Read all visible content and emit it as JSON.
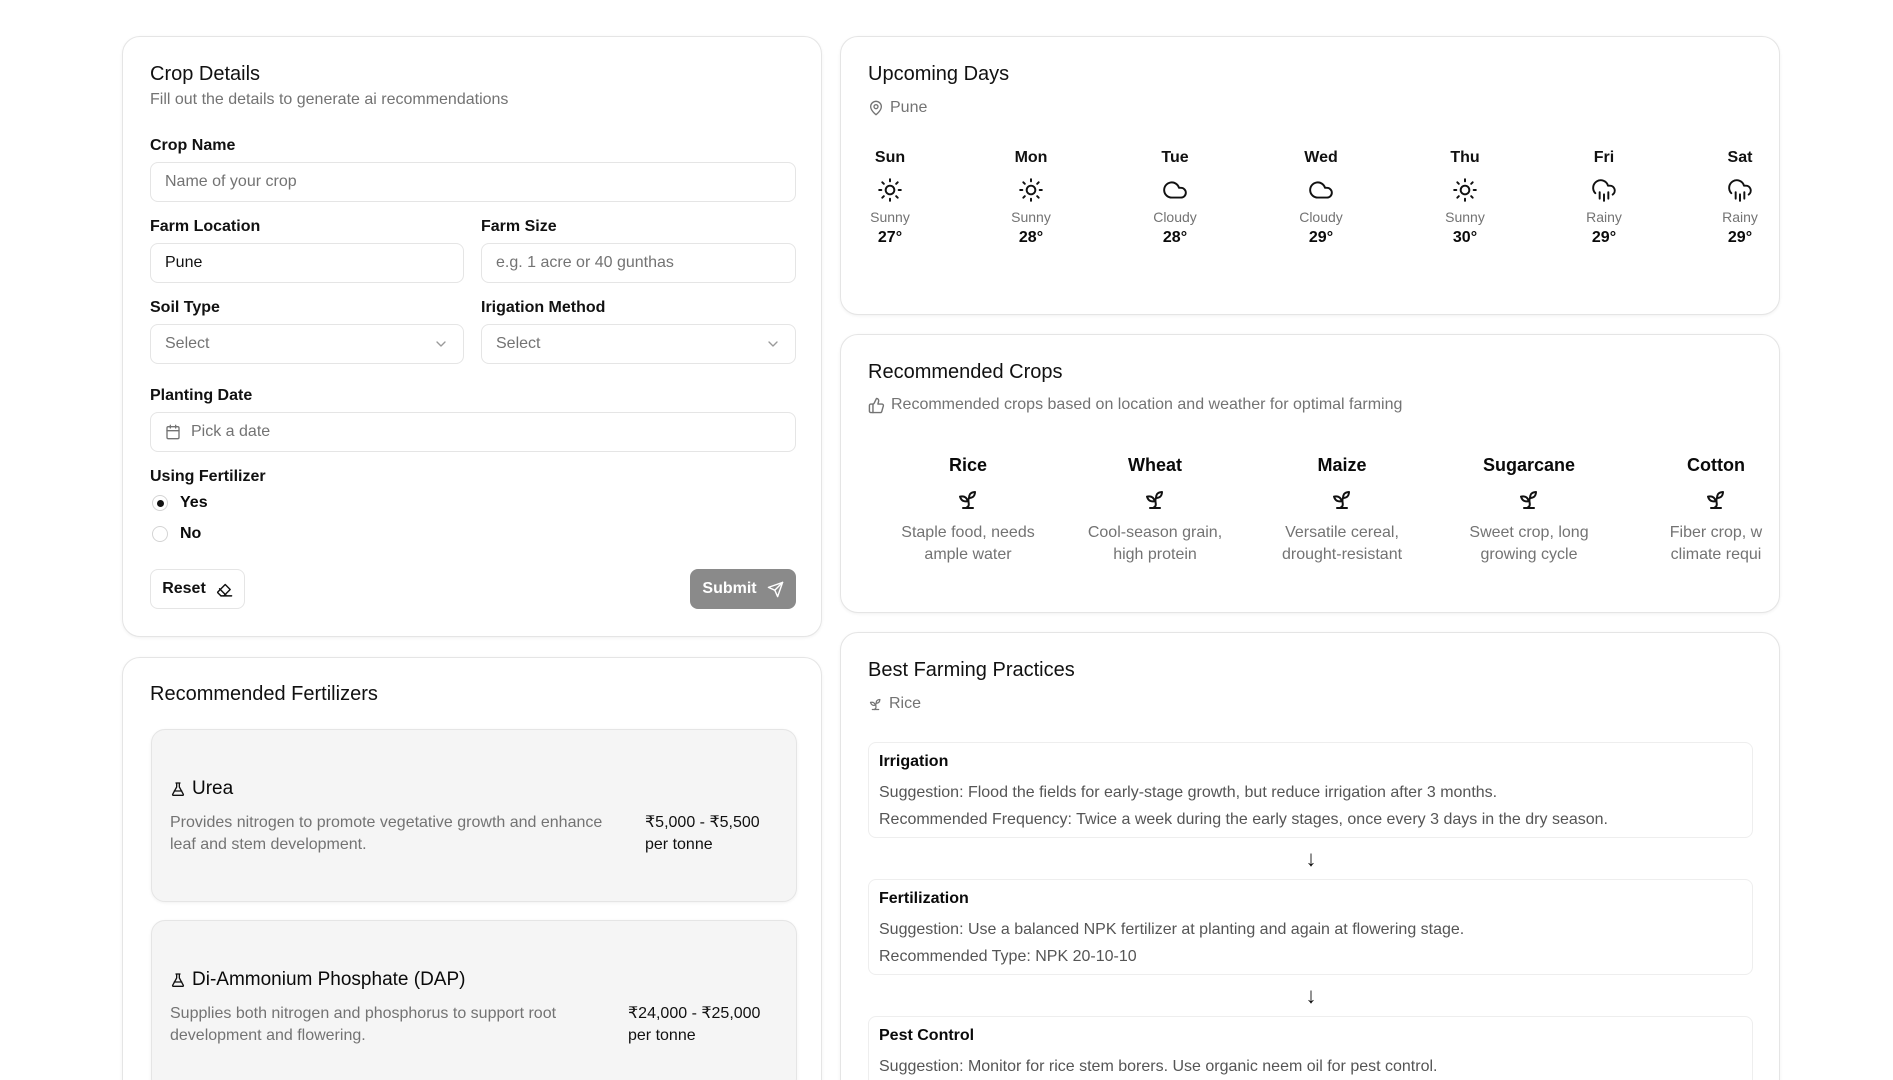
{
  "crop_details": {
    "title": "Crop Details",
    "description": "Fill out the details to generate ai recommendations",
    "crop_name_label": "Crop Name",
    "crop_name_placeholder": "Name of your crop",
    "farm_location_label": "Farm Location",
    "farm_location_value": "Pune",
    "farm_size_label": "Farm Size",
    "farm_size_placeholder": "e.g. 1 acre or 40 gunthas",
    "soil_type_label": "Soil Type",
    "soil_type_value": "Select",
    "irrigation_label": "Irigation Method",
    "irrigation_value": "Select",
    "planting_date_label": "Planting Date",
    "planting_date_placeholder": "Pick a date",
    "fertilizer_label": "Using Fertilizer",
    "fertilizer_options": [
      "Yes",
      "No"
    ],
    "fertilizer_selected": "Yes",
    "reset_label": "Reset",
    "submit_label": "Submit"
  },
  "weather": {
    "title": "Upcoming Days",
    "location": "Pune",
    "days": [
      {
        "day": "Sun",
        "condition": "Sunny",
        "temp": "27°",
        "icon": "sun-icon"
      },
      {
        "day": "Mon",
        "condition": "Sunny",
        "temp": "28°",
        "icon": "sun-icon"
      },
      {
        "day": "Tue",
        "condition": "Cloudy",
        "temp": "28°",
        "icon": "cloud-icon"
      },
      {
        "day": "Wed",
        "condition": "Cloudy",
        "temp": "29°",
        "icon": "cloud-icon"
      },
      {
        "day": "Thu",
        "condition": "Sunny",
        "temp": "30°",
        "icon": "sun-icon"
      },
      {
        "day": "Fri",
        "condition": "Rainy",
        "temp": "29°",
        "icon": "rain-icon"
      },
      {
        "day": "Sat",
        "condition": "Rainy",
        "temp": "29°",
        "icon": "rain-icon"
      }
    ]
  },
  "recommended_crops": {
    "title": "Recommended Crops",
    "description": "Recommended crops based on location and weather for optimal farming",
    "crops": [
      {
        "name": "Rice",
        "line1": "Staple food, needs",
        "line2": "ample water"
      },
      {
        "name": "Wheat",
        "line1": "Cool-season grain,",
        "line2": "high protein"
      },
      {
        "name": "Maize",
        "line1": "Versatile cereal,",
        "line2": "drought-resistant"
      },
      {
        "name": "Sugarcane",
        "line1": "Sweet crop, long",
        "line2": "growing cycle"
      },
      {
        "name": "Cotton",
        "line1": "Fiber crop, w",
        "line2": "climate requi"
      }
    ]
  },
  "fertilizers": {
    "title": "Recommended Fertilizers",
    "items": [
      {
        "name": "Urea",
        "line1": "Provides nitrogen to promote vegetative growth and enhance",
        "line2": "leaf and stem development.",
        "price": "₹5,000 - ₹5,500",
        "unit": "per tonne"
      },
      {
        "name": "Di-Ammonium Phosphate (DAP)",
        "line1": "Supplies both nitrogen and phosphorus to support root",
        "line2": "development and flowering.",
        "price": "₹24,000 - ₹25,000",
        "unit": "per tonne"
      }
    ]
  },
  "practices": {
    "title": "Best Farming Practices",
    "crop": "Rice",
    "arrow": "↓",
    "items": [
      {
        "title": "Irrigation",
        "line1": "Suggestion: Flood the fields for early-stage growth, but reduce irrigation after 3 months.",
        "line2": "Recommended Frequency: Twice a week during the early stages, once every 3 days in the dry season."
      },
      {
        "title": "Fertilization",
        "line1": "Suggestion: Use a balanced NPK fertilizer at planting and again at flowering stage.",
        "line2": "Recommended Type: NPK 20-10-10"
      },
      {
        "title": "Pest Control",
        "line1": "Suggestion: Monitor for rice stem borers. Use organic neem oil for pest control.",
        "line2": ""
      }
    ]
  }
}
